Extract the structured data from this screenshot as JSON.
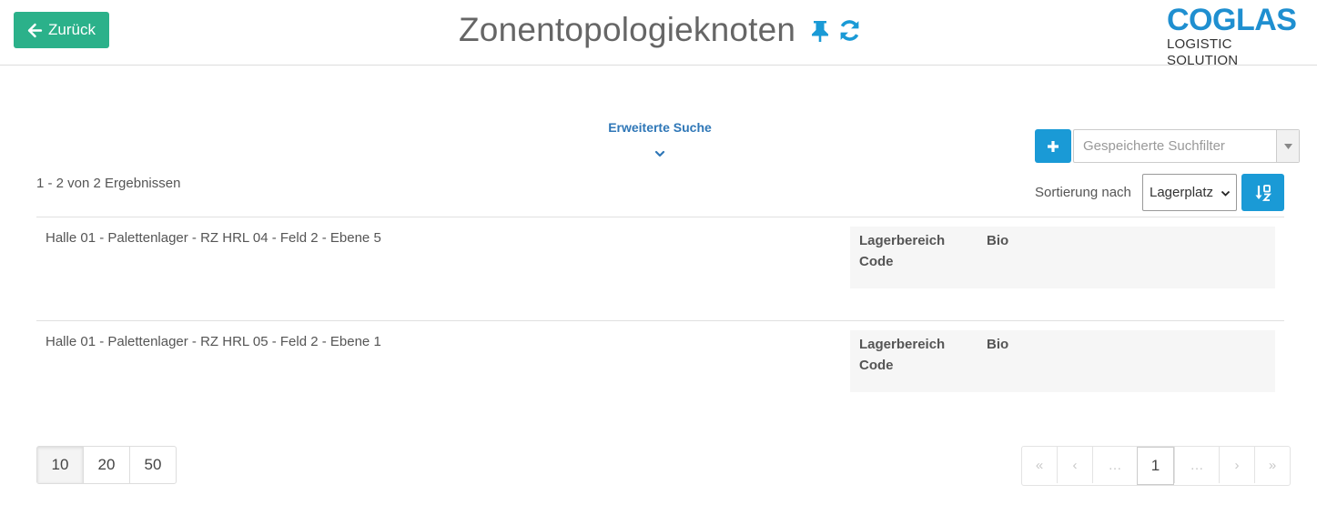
{
  "header": {
    "back_label": "Zurück",
    "title": "Zonentopologieknoten",
    "icons": [
      "arrow-left-icon",
      "pin-icon",
      "refresh-icon"
    ],
    "logo_main": "COGLAS",
    "logo_sub": "LOGISTIC SOLUTION"
  },
  "search": {
    "advanced_label": "Erweiterte Suche",
    "saved_filter_placeholder": "Gespeicherte Suchfilter"
  },
  "results": {
    "count_text": "1 - 2 von 2 Ergebnissen",
    "sort_label": "Sortierung nach",
    "sort_value": "Lagerplatz",
    "items": [
      {
        "title": "Halle 01 - Palettenlager - RZ HRL 04 - Feld 2 - Ebene 5",
        "attr_label": "Lagerbereich Code",
        "attr_value": "Bio"
      },
      {
        "title": "Halle 01 - Palettenlager - RZ HRL 05 - Feld 2 - Ebene 1",
        "attr_label": "Lagerbereich Code",
        "attr_value": "Bio"
      }
    ]
  },
  "pagination": {
    "page_sizes": [
      "10",
      "20",
      "50"
    ],
    "selected_page_size": "10",
    "first": "«",
    "prev": "‹",
    "ellipsis": "…",
    "current_page": "1",
    "next": "›",
    "last": "»"
  },
  "colors": {
    "back_button": "#2bb18a",
    "primary_blue": "#1a9ad6",
    "logo_blue": "#1f8fd0",
    "link_blue": "#2f77b7"
  }
}
